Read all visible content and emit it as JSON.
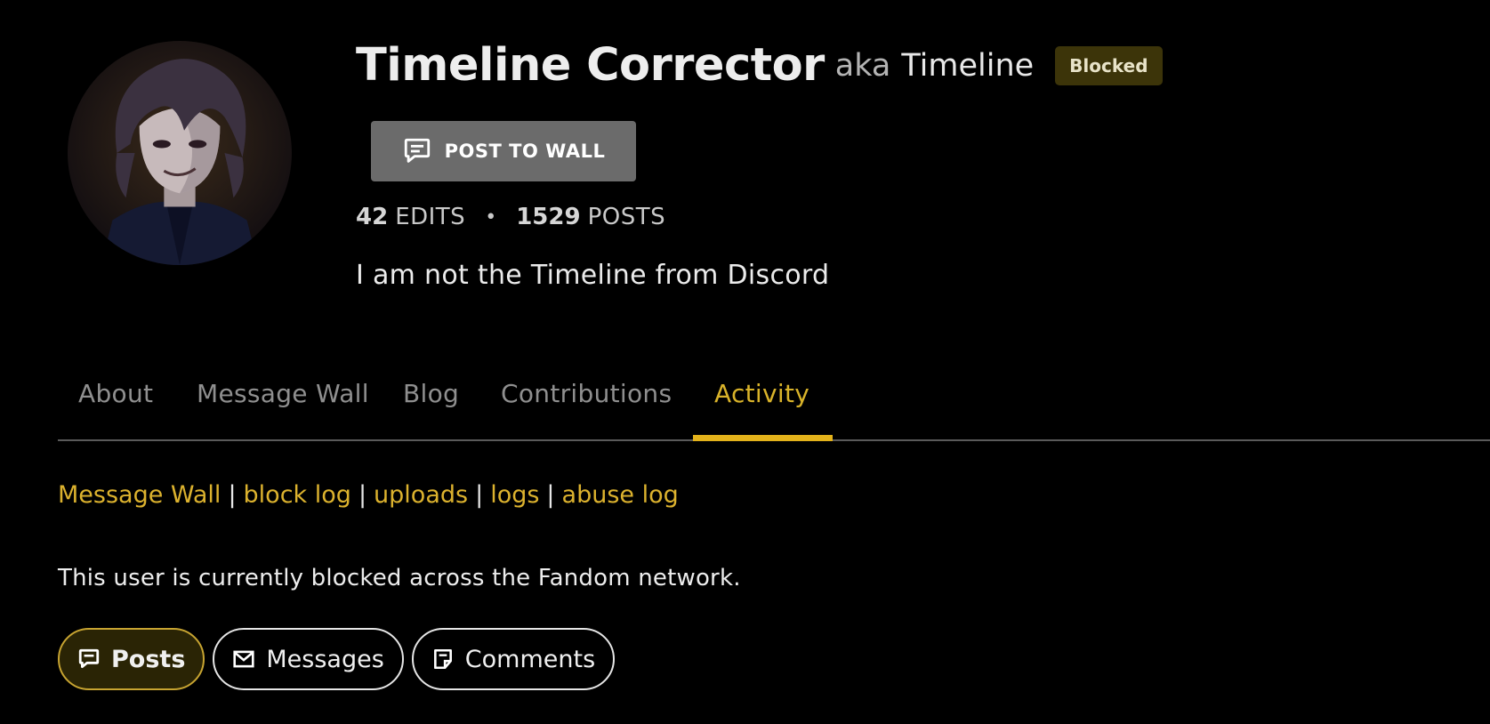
{
  "profile": {
    "username": "Timeline Corrector",
    "aka_label": "aka",
    "aka_name": "Timeline",
    "status_badge": "Blocked",
    "post_to_wall_label": "POST TO WALL",
    "stats": {
      "edits_count": "42",
      "edits_label": "EDITS",
      "separator": "•",
      "posts_count": "1529",
      "posts_label": "POSTS"
    },
    "bio": "I am not the Timeline from Discord",
    "avatar_icon": "user-avatar"
  },
  "tabs": [
    {
      "label": "About",
      "active": false
    },
    {
      "label": "Message Wall",
      "active": false
    },
    {
      "label": "Blog",
      "active": false
    },
    {
      "label": "Contributions",
      "active": false
    },
    {
      "label": "Activity",
      "active": true
    }
  ],
  "links": [
    "Message Wall",
    "block log",
    "uploads",
    "logs",
    "abuse log"
  ],
  "link_separator": "|",
  "blocked_message": "This user is currently blocked across the Fandom network.",
  "filters": [
    {
      "label": "Posts",
      "icon": "speech-bubble-icon",
      "active": true
    },
    {
      "label": "Messages",
      "icon": "envelope-icon",
      "active": false
    },
    {
      "label": "Comments",
      "icon": "comment-note-icon",
      "active": false
    }
  ],
  "colors": {
    "background": "#000000",
    "accent": "#e3b21b",
    "link": "#dcb22e",
    "badge_bg": "#3c3409",
    "button_bg": "#6b6b6b"
  }
}
